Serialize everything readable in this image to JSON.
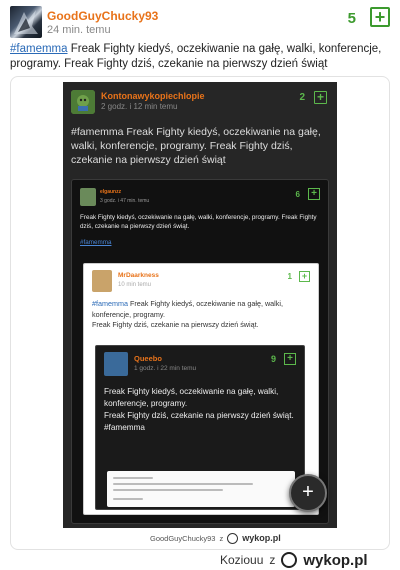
{
  "post": {
    "author": "GoodGuyChucky93",
    "time": "24 min. temu",
    "score": "5",
    "plus": "+",
    "tag": "#famemma",
    "text": " Freak Fighty kiedyś, oczekiwanie na gałę, walki, konferencje, programy. Freak Fighty dziś, czekanie na pierwszy dzień świąt"
  },
  "screenshot": {
    "author": "Kontonawykopiechlopie",
    "time": "2 godz. i 12 min temu",
    "score": "2",
    "plus": "+",
    "text": "#famemma Freak Fighty kiedyś, oczekiwanie na gałę, walki, konferencje, programy. Freak Fighty dziś, czekanie na pierwszy dzień świąt",
    "nested1": {
      "author": "elgaunzz",
      "time": "3 godz. i 47 min. temu",
      "score": "6",
      "plus": "+",
      "text": "Freak Fighty kiedyś, oczekiwanie na gałę, walki, konferencje, programy. Freak Fighty dziś, czekanie na pierwszy dzień świąt.",
      "tag": "#famemma"
    },
    "nested2": {
      "author": "MrDaarkness",
      "time": "10 min temu",
      "score": "1",
      "plus": "+",
      "tag": "#famemma",
      "text1": " Freak Fighty kiedyś, oczekiwanie na gałę, walki, konferencje, programy.",
      "text2": "Freak Fighty dziś, czekanie na pierwszy dzień świąt."
    },
    "nested3": {
      "author": "Queebo",
      "time": "1 godz. i 22 min temu",
      "score": "9",
      "plus": "+",
      "text1": "Freak Fighty kiedyś, oczekiwanie na gałę, walki, konferencje, programy.",
      "text2": "Freak Fighty dziś, czekanie na pierwszy dzień świąt.",
      "tag": "#famemma"
    },
    "fab": "+",
    "signature_user": "GoodGuyChucky93",
    "signature_sep": "z",
    "signature_logo": "wykop.pl"
  },
  "bottom": {
    "user": "Koziouu",
    "sep": "z",
    "logo": "wykop.pl"
  },
  "colors": {
    "accent_orange": "#e8731a",
    "vote_green": "#3c9a2e",
    "link_blue": "#2a6ab7"
  },
  "icons": [
    "plus-icon",
    "wykop-logo-icon"
  ]
}
